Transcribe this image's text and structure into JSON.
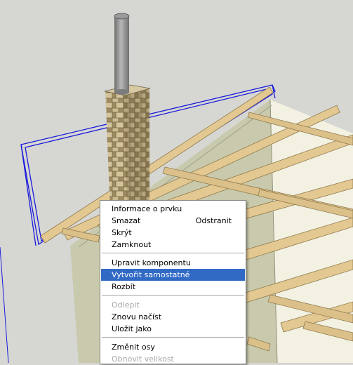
{
  "scene": {
    "colors": {
      "background": "#d6d7d3",
      "wall_shadow": "#c9caad",
      "wall_light": "#f2f1e2",
      "rafter": "#e3c891",
      "selection": "#1a1adc",
      "chimney_stone": "#b9a57b",
      "pipe": "#9a9a9a"
    }
  },
  "context_menu": {
    "items": [
      {
        "label": "Informace o prvku",
        "shortcut": "",
        "state": "normal"
      },
      {
        "label": "Smazat",
        "shortcut": "Odstranit",
        "state": "normal"
      },
      {
        "label": "Skrýt",
        "shortcut": "",
        "state": "normal"
      },
      {
        "label": "Zamknout",
        "shortcut": "",
        "state": "normal"
      },
      {
        "label": "Upravit komponentu",
        "shortcut": "",
        "state": "normal"
      },
      {
        "label": "Vytvořit samostatné",
        "shortcut": "",
        "state": "selected"
      },
      {
        "label": "Rozbít",
        "shortcut": "",
        "state": "normal"
      },
      {
        "label": "Odlepit",
        "shortcut": "",
        "state": "disabled"
      },
      {
        "label": "Znovu načíst",
        "shortcut": "",
        "state": "normal"
      },
      {
        "label": "Uložit jako",
        "shortcut": "",
        "state": "normal"
      },
      {
        "label": "Změnit osy",
        "shortcut": "",
        "state": "normal"
      },
      {
        "label": "Obnovit velikost",
        "shortcut": "",
        "state": "disabled"
      }
    ]
  }
}
